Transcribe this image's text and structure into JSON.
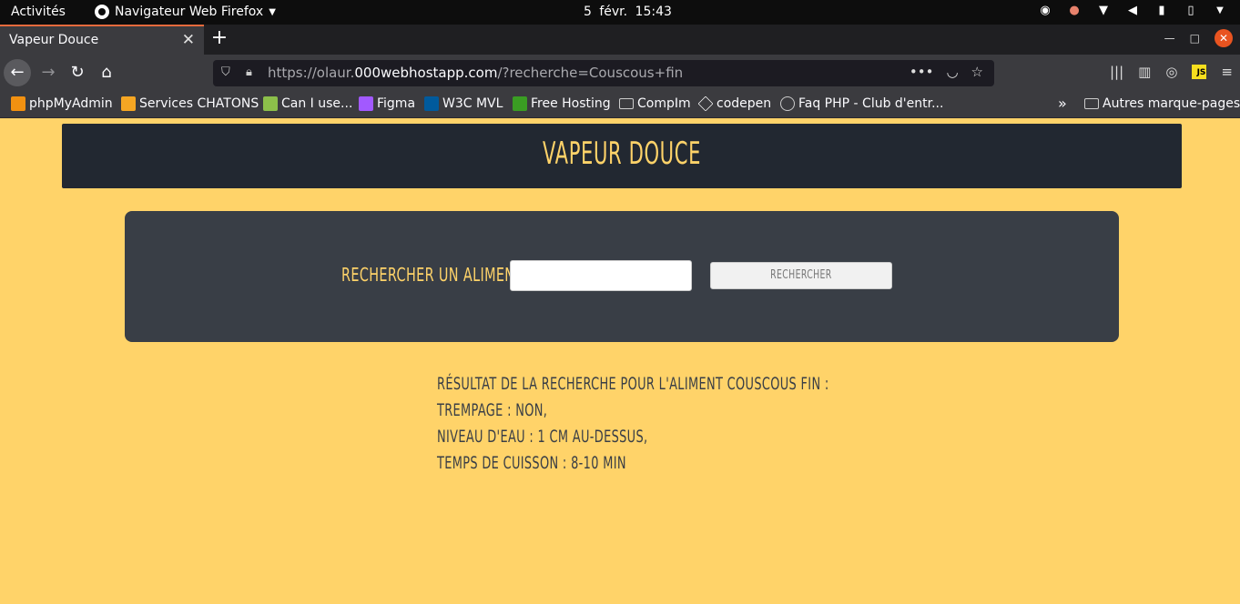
{
  "system_bar": {
    "activities": "Activités",
    "app_name": "Navigateur Web Firefox",
    "clock": "5 févr.  15:43",
    "tray_icons": [
      "discord-icon",
      "notification-icon",
      "wifi-icon",
      "volume-icon",
      "microphone-icon",
      "battery-icon",
      "power-menu-icon"
    ]
  },
  "browser": {
    "tab_title": "Vapeur Douce",
    "url_prefix": "https://olaur.",
    "url_domain": "000webhostapp.com",
    "url_path": "/?recherche=Couscous+fin",
    "bookmarks": [
      {
        "label": "phpMyAdmin",
        "icon": "phpmyadmin-icon",
        "color": "#f29111"
      },
      {
        "label": "Services CHATONS",
        "icon": "chatons-icon",
        "color": "#f5a623"
      },
      {
        "label": "Can I use...",
        "icon": "caniuse-icon",
        "color": "#8cbf4a"
      },
      {
        "label": "Figma",
        "icon": "figma-icon",
        "color": "#a259ff"
      },
      {
        "label": "W3C MVL",
        "icon": "w3c-icon",
        "color": "#005a9c"
      },
      {
        "label": "Free Hosting",
        "icon": "freehosting-icon",
        "color": "#3a9d23"
      },
      {
        "label": "CompIm",
        "icon": "folder-icon",
        "color": "#cccccc"
      },
      {
        "label": "codepen",
        "icon": "codepen-icon",
        "color": "#ffffff"
      },
      {
        "label": "Faq PHP - Club d'entr...",
        "icon": "globe-icon",
        "color": "#cccccc"
      }
    ],
    "other_bookmarks": "Autres marque-pages"
  },
  "page": {
    "site_title": "VAPEUR DOUCE",
    "search_label": "RECHERCHER UN ALIMENT",
    "search_value": "",
    "search_button": "RECHERCHER",
    "results": [
      "RÉSULTAT DE LA RECHERCHE POUR L'ALIMENT COUSCOUS FIN :",
      "TREMPAGE : NON,",
      "NIVEAU D'EAU : 1 CM AU-DESSUS,",
      "TEMPS DE CUISSON : 8-10 MIN"
    ],
    "colors": {
      "background": "#ffd369",
      "header": "#222831",
      "panel": "#393e46",
      "accent": "#ffd369"
    }
  }
}
